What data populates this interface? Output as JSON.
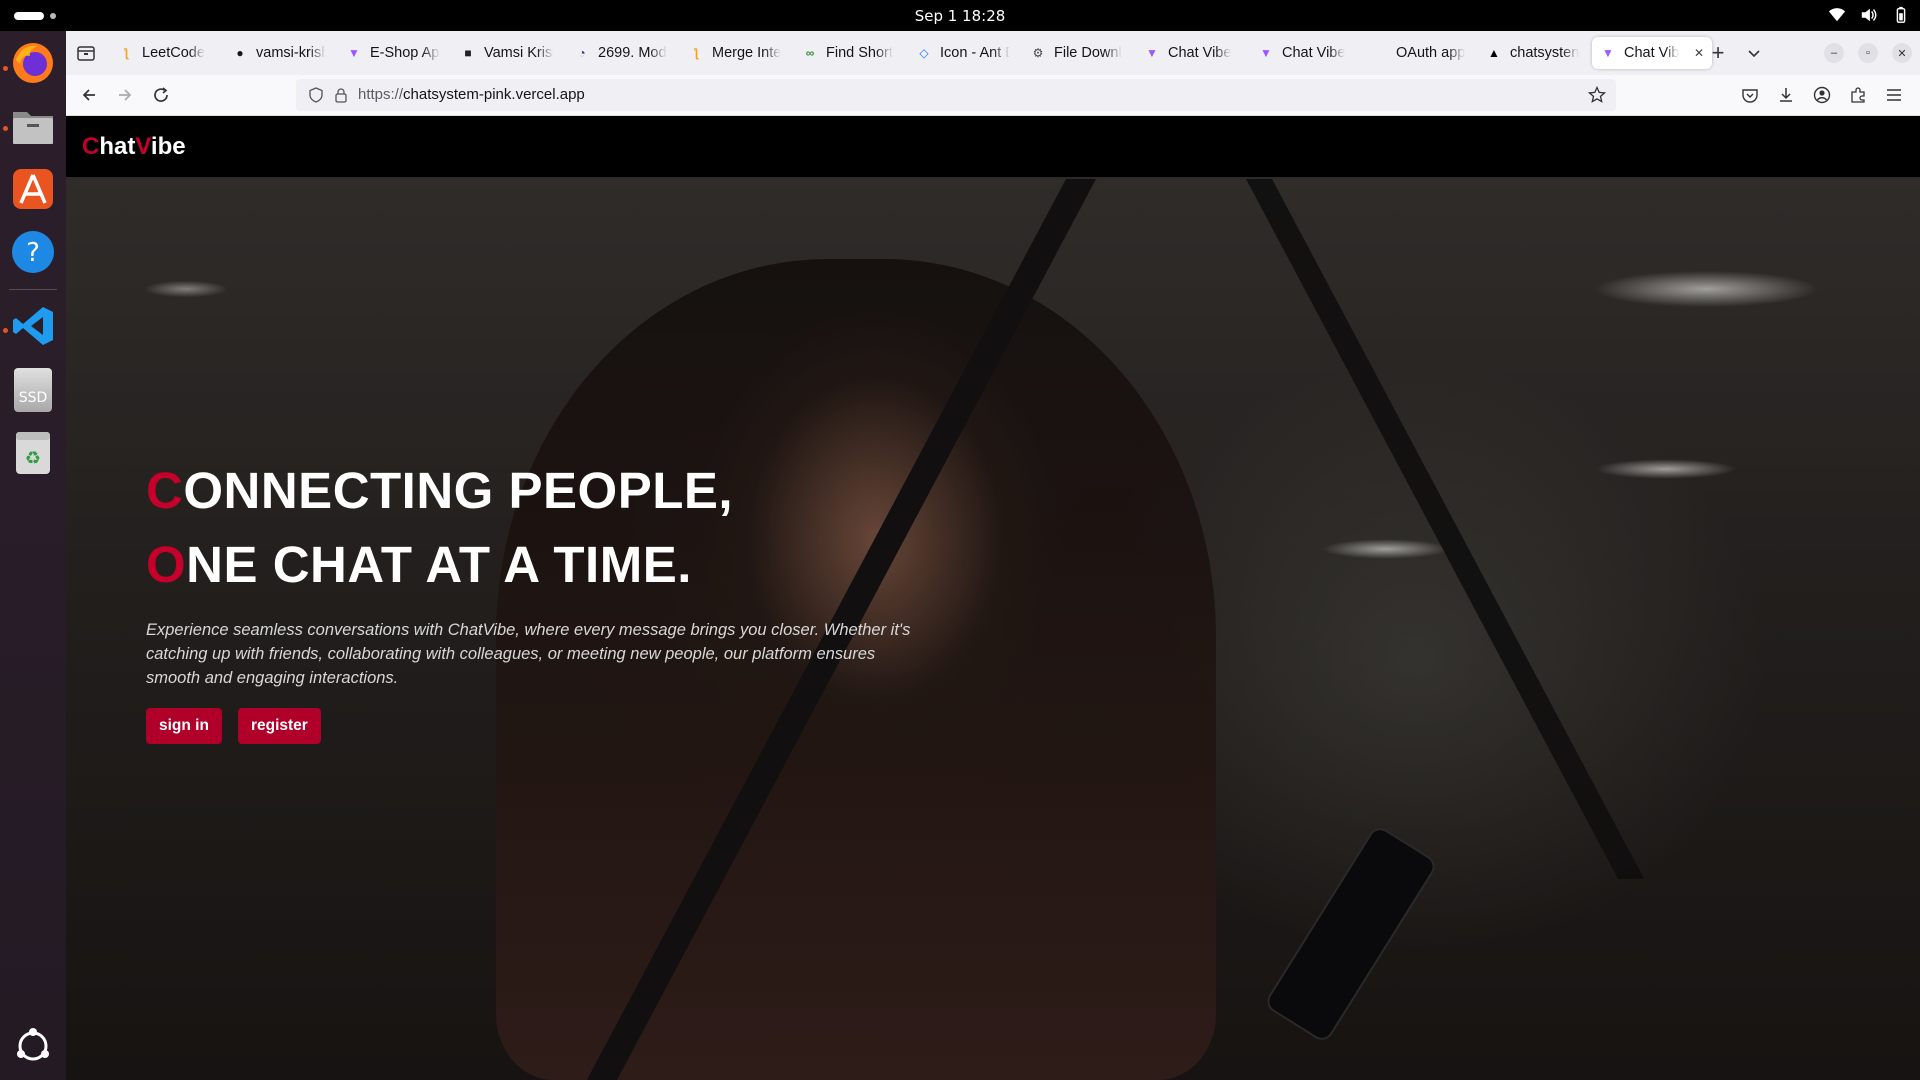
{
  "system": {
    "clock": "Sep 1  18:28"
  },
  "dock": {
    "items": [
      "Firefox",
      "Files",
      "App Center",
      "Help",
      "Visual Studio Code",
      "SSD",
      "Trash",
      "Show Apps"
    ],
    "ssd_label": "SSD"
  },
  "browser": {
    "tabs": [
      {
        "title": "LeetCode",
        "icon": "leetcode-icon"
      },
      {
        "title": "vamsi-krish",
        "icon": "github-icon"
      },
      {
        "title": "E-Shop App",
        "icon": "vite-icon"
      },
      {
        "title": "Vamsi Krish",
        "icon": "dark-square-icon"
      },
      {
        "title": "2699. Mod",
        "icon": "gauge-icon"
      },
      {
        "title": "Merge Inte",
        "icon": "leetcode-icon"
      },
      {
        "title": "Find Short",
        "icon": "infinity-icon"
      },
      {
        "title": "Icon - Ant D",
        "icon": "antd-icon"
      },
      {
        "title": "File Downl",
        "icon": "gear-icon"
      },
      {
        "title": "Chat Vibe",
        "icon": "vite-icon"
      },
      {
        "title": "Chat Vibe",
        "icon": "vite-icon"
      },
      {
        "title": "OAuth app",
        "icon": "none"
      },
      {
        "title": "chatsysten",
        "icon": "vercel-icon"
      },
      {
        "title": "Chat Vib",
        "icon": "vite-icon",
        "active": true
      }
    ],
    "url": {
      "scheme": "https://",
      "host": "chatsystem-pink.vercel.app"
    }
  },
  "site": {
    "logo": {
      "c": "C",
      "hat": "hat",
      "v": "V",
      "ibe": "ibe"
    },
    "hero": {
      "line1_first": "C",
      "line1_rest": "ONNECTING PEOPLE,",
      "line2_first": "O",
      "line2_rest": "NE CHAT AT A TIME.",
      "description": "Experience seamless conversations with ChatVibe, where every message brings you closer. Whether it's catching up with friends, collaborating with colleagues, or meeting new people, our platform ensures smooth and engaging interactions.",
      "sign_in_label": "sign in",
      "register_label": "register"
    }
  },
  "colors": {
    "accent": "#c4002b",
    "button": "#b0002a",
    "header": "#000000"
  }
}
